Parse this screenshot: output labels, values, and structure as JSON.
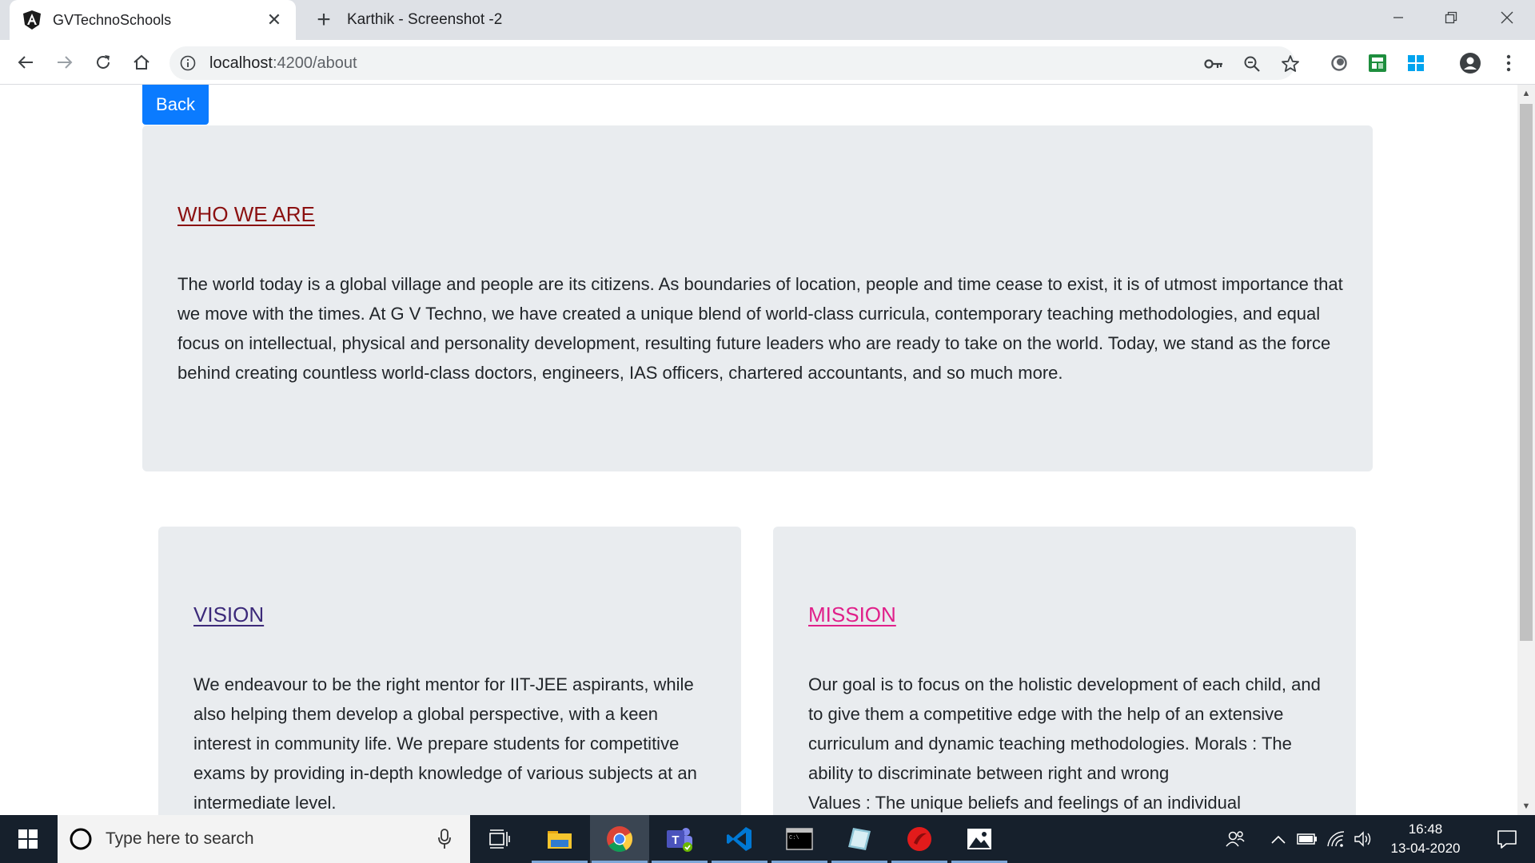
{
  "browser": {
    "tab": {
      "title": "GVTechnoSchools",
      "favicon": "angular-icon"
    },
    "window_title": "Karthik - Screenshot -2",
    "url": {
      "host": "localhost",
      "rest": ":4200/about"
    }
  },
  "page": {
    "back_label": "Back",
    "who": {
      "heading": "WHO WE ARE",
      "text": "The world today is a global village and people are its citizens. As boundaries of location, people and time cease to exist, it is of utmost importance that we move with the times. At G V Techno, we have created a unique blend of world-class curricula, contemporary teaching methodologies, and equal focus on intellectual, physical and personality development, resulting future leaders who are ready to take on the world. Today, we stand as the force behind creating countless world-class doctors, engineers, IAS officers, chartered accountants, and so much more."
    },
    "vision": {
      "heading": "VISION",
      "text": "We endeavour to be the right mentor for IIT-JEE aspirants, while also helping them develop a global perspective, with a keen interest in community life. We prepare students for competitive exams by providing in-depth knowledge of various subjects at an intermediate level."
    },
    "mission": {
      "heading": "MISSION",
      "text_line1": "Our goal is to focus on the holistic development of each child, and to give them a competitive edge with the help of an extensive curriculum and dynamic teaching methodologies. Morals : The ability to discriminate between right and wrong",
      "text_line2": "Values : The unique beliefs and feelings of an individual"
    }
  },
  "taskbar": {
    "search_placeholder": "Type here to search",
    "time": "16:48",
    "date": "13-04-2020"
  },
  "colors": {
    "back_button": "#0b7bff",
    "card_bg": "#e9ecef",
    "who_heading": "#8b1010",
    "vision_heading": "#3c2a7a",
    "mission_heading": "#e0208a",
    "taskbar": "#16202c"
  }
}
